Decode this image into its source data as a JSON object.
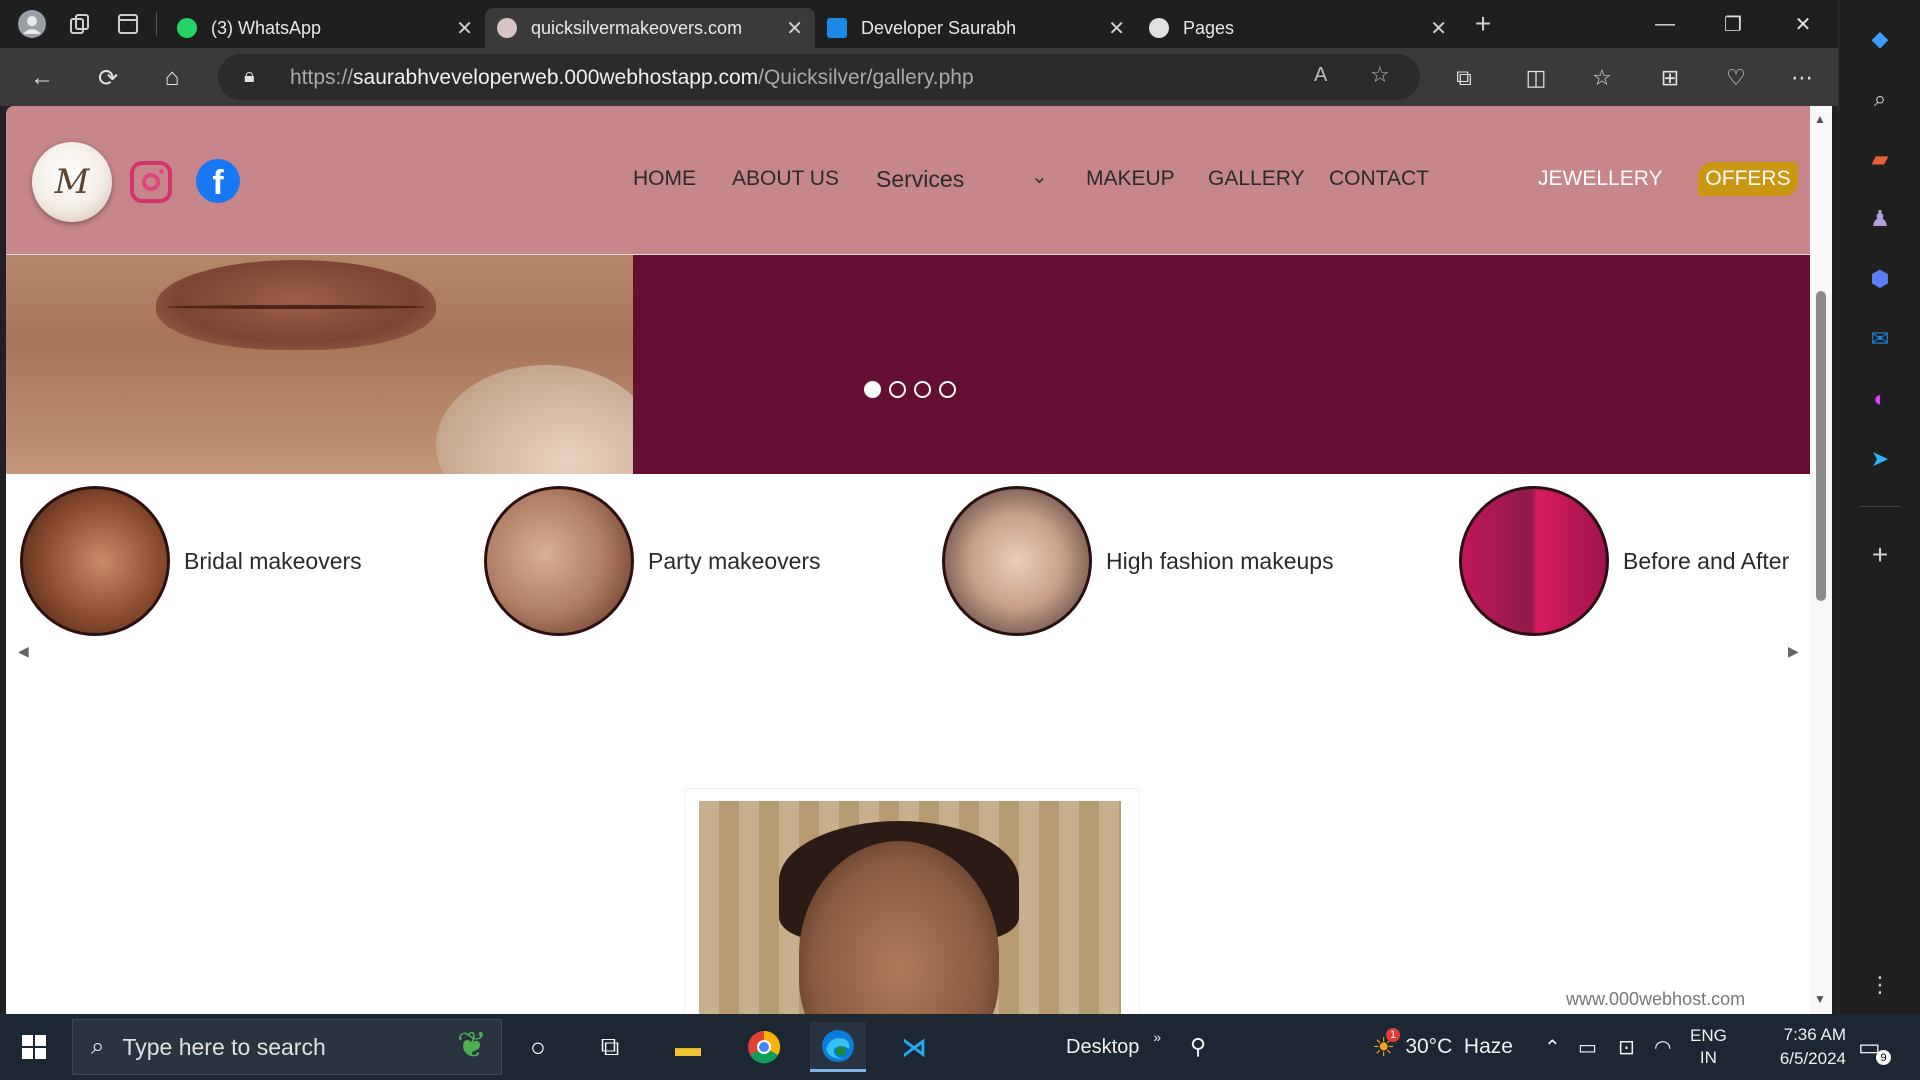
{
  "browser": {
    "tabs": [
      {
        "title": "(3) WhatsApp",
        "icon": "whatsapp-icon",
        "active": false
      },
      {
        "title": "quicksilvermakeovers.com",
        "icon": "site-favicon",
        "active": true
      },
      {
        "title": "Developer Saurabh",
        "icon": "developer-favicon",
        "active": false
      },
      {
        "title": "Pages",
        "icon": "github-icon",
        "active": false
      }
    ],
    "url_scheme": "https://",
    "url_host": "saurabhveveloperweb.000webhostapp.com",
    "url_path": "/Quicksilver/gallery.php",
    "close_glyph": "✕"
  },
  "site": {
    "nav": {
      "home": "HOME",
      "about": "ABOUT US",
      "services": "Services",
      "makeup": "MAKEUP",
      "gallery": "GALLERY",
      "contact": "CONTACT",
      "jewellery": "JEWELLERY",
      "offers": "OFFERS"
    },
    "slider": {
      "slide_count": 4,
      "active_index": 0
    },
    "categories": [
      {
        "label": "Bridal makeovers"
      },
      {
        "label": "Party makeovers"
      },
      {
        "label": "High fashion makeups"
      },
      {
        "label": "Before and After"
      }
    ],
    "host_badge": "www.000webhost.com"
  },
  "taskbar": {
    "search_placeholder": "Type here to search",
    "desktop_label": "Desktop",
    "weather": "30°C  Haze",
    "weather_badge": "1",
    "lang_line1": "ENG",
    "lang_line2": "IN",
    "time": "7:36 AM",
    "date": "6/5/2024",
    "notif_count": "9"
  },
  "colors": {
    "header_pink": "#c78689",
    "hero_maroon": "#650e33",
    "offers_gold": "#c99712",
    "taskbar": "#1c2733"
  }
}
